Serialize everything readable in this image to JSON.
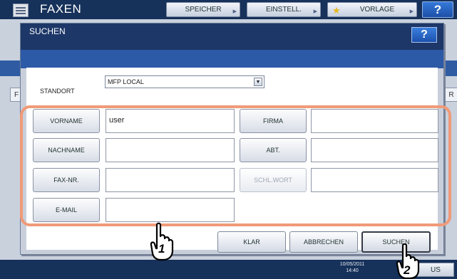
{
  "app": {
    "title": "FAXEN"
  },
  "top_buttons": {
    "speicher": "SPEICHER",
    "einstell": "EINSTELL.",
    "vorlage": "VORLAGE",
    "help": "?"
  },
  "dialog": {
    "title": "SUCHEN",
    "help": "?"
  },
  "location": {
    "label": "STANDORT",
    "value": "MFP LOCAL"
  },
  "fields": {
    "vorname": {
      "label": "VORNAME",
      "value": "user"
    },
    "nachname": {
      "label": "NACHNAME",
      "value": ""
    },
    "fax": {
      "label": "FAX-NR.",
      "value": ""
    },
    "email": {
      "label": "E-MAIL",
      "value": ""
    },
    "firma": {
      "label": "FIRMA",
      "value": ""
    },
    "abt": {
      "label": "ABT.",
      "value": ""
    },
    "schlwort": {
      "label": "SCHL.WORT",
      "value": ""
    }
  },
  "actions": {
    "klar": "KLAR",
    "abbrechen": "ABBRECHEN",
    "suchen": "SUCHEN"
  },
  "status": {
    "date": "10/05/2011",
    "time": "14:40",
    "us_label": "US"
  },
  "callouts": {
    "one": "1",
    "two": "2"
  },
  "colors": {
    "highlight": "#f09a78",
    "header": "#1d3768"
  }
}
